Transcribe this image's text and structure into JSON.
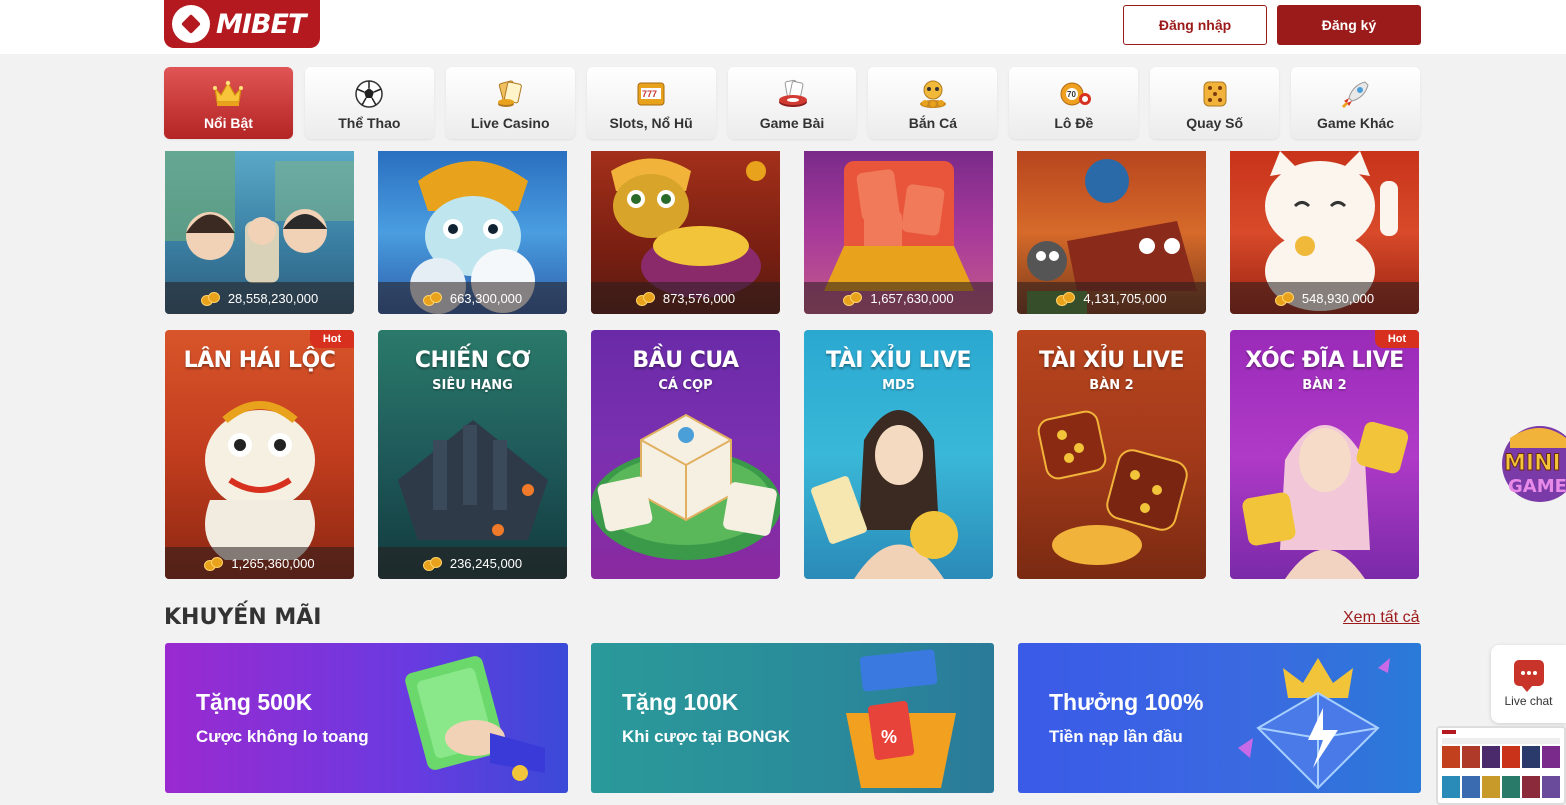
{
  "header": {
    "logo_text": "MIBET",
    "login_label": "Đăng nhập",
    "register_label": "Đăng ký"
  },
  "nav": {
    "items": [
      {
        "label": "Nổi Bật",
        "icon": "crown-icon"
      },
      {
        "label": "Thể Thao",
        "icon": "soccer-ball-icon"
      },
      {
        "label": "Live Casino",
        "icon": "cards-chips-icon"
      },
      {
        "label": "Slots, Nổ Hũ",
        "icon": "slot-machine-icon"
      },
      {
        "label": "Game Bài",
        "icon": "poker-chip-icon"
      },
      {
        "label": "Bắn Cá",
        "icon": "fish-icon"
      },
      {
        "label": "Lô Đề",
        "icon": "lottery-ball-icon"
      },
      {
        "label": "Quay Số",
        "icon": "dice-icon"
      },
      {
        "label": "Game Khác",
        "icon": "rocket-icon"
      }
    ]
  },
  "games_row1": [
    {
      "jackpot": "28,558,230,000"
    },
    {
      "jackpot": "663,300,000"
    },
    {
      "jackpot": "873,576,000"
    },
    {
      "jackpot": "1,657,630,000"
    },
    {
      "jackpot": "4,131,705,000"
    },
    {
      "jackpot": "548,930,000"
    }
  ],
  "games_row2": [
    {
      "title": "LÂN HÁI LỘC",
      "sub": "",
      "jackpot": "1,265,360,000",
      "hot": "Hot"
    },
    {
      "title": "CHIẾN CƠ",
      "sub": "SIÊU HẠNG",
      "jackpot": "236,245,000",
      "hot": ""
    },
    {
      "title": "BẦU CUA",
      "sub": "CÁ CỌP",
      "jackpot": "",
      "hot": ""
    },
    {
      "title": "TÀI XỈU LIVE",
      "sub": "MD5",
      "jackpot": "",
      "hot": ""
    },
    {
      "title": "TÀI XỈU LIVE",
      "sub": "BÀN 2",
      "jackpot": "",
      "hot": ""
    },
    {
      "title": "XÓC ĐĨA LIVE",
      "sub": "BÀN 2",
      "jackpot": "",
      "hot": "Hot"
    }
  ],
  "promotions": {
    "title": "KHUYẾN MÃI",
    "see_all": "Xem tất cả",
    "cards": [
      {
        "main": "Tặng 500K",
        "sub": "Cược không lo toang"
      },
      {
        "main": "Tặng 100K",
        "sub": "Khi cược tại BONGK"
      },
      {
        "main": "Thưởng 100%",
        "sub": "Tiền nạp lần đầu"
      }
    ]
  },
  "float": {
    "live_chat_label": "Live chat",
    "mini_game_text": "MINI GAME"
  }
}
